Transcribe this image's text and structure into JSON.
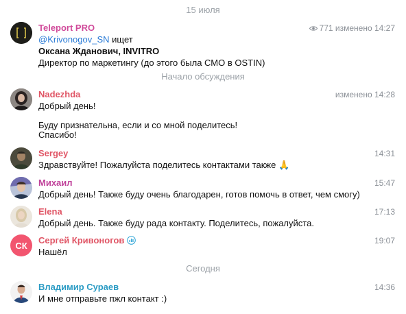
{
  "dividers": {
    "date": "15 июля",
    "discussion": "Начало обсуждения",
    "today": "Сегодня"
  },
  "channel_post": {
    "author": "Teleport PRO",
    "author_color": "#d04a9a",
    "views": "771",
    "edited_time": "изменено 14:27",
    "mention": "@Krivonogov_SN",
    "mention_suffix": " ищет",
    "line2": "Оксана Жданович, INVITRO",
    "line3": "Директор по маркетингу (до этого была СМО в OSTIN)"
  },
  "messages": [
    {
      "name": "Nadezhda",
      "color": "#e05565",
      "time": "изменено 14:28",
      "lines": [
        "Добрый день!",
        "",
        "Буду признательна, если и со мной поделитесь!",
        "Спасибо!"
      ]
    },
    {
      "name": "Sergey",
      "color": "#e05565",
      "time": "14:31",
      "lines": [
        "Здравствуйте! Пожалуйста поделитесь контактами также 🙏"
      ]
    },
    {
      "name": "Михаил",
      "color": "#c0429a",
      "time": "15:47",
      "lines": [
        "Добрый день! Также буду очень благодарен, готов помочь в ответ, чем смогу)"
      ]
    },
    {
      "name": "Elena",
      "color": "#e05565",
      "time": "17:13",
      "lines": [
        "Добрый день. Также буду рада контакту. Поделитесь, пожалуйста."
      ]
    },
    {
      "name": "Сергей Кривоногов",
      "color": "#e05565",
      "time": "19:07",
      "initials": "СК",
      "lines": [
        "Нашёл"
      ]
    },
    {
      "name": "Владимир Сураев",
      "color": "#2a9bc4",
      "time": "14:36",
      "lines": [
        "И мне отправьте пжл контакт :)"
      ]
    }
  ],
  "colors": {
    "accent_link": "#2a7bd6",
    "sk_avatar": "#f2556f"
  }
}
